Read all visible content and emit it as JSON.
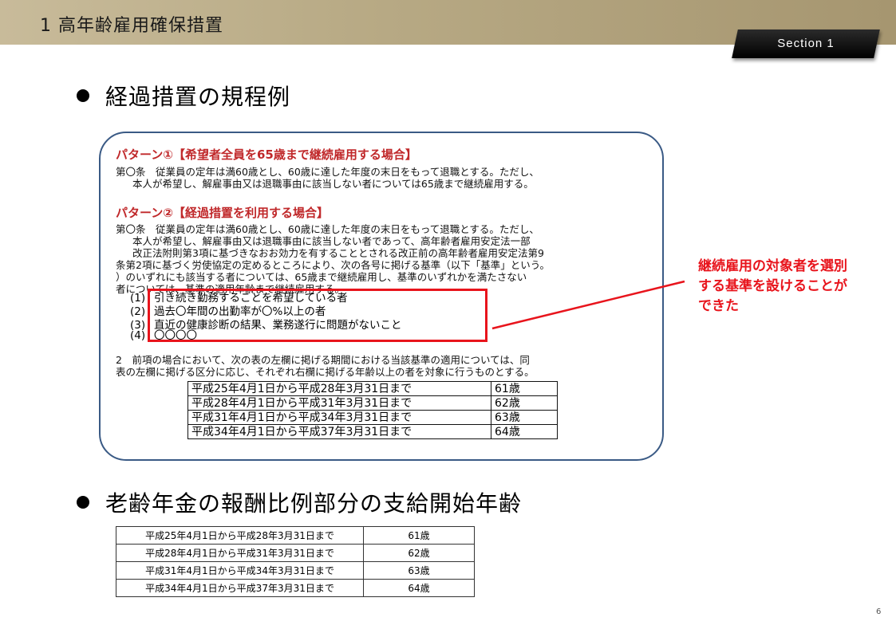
{
  "header": {
    "title": "1 高年齢雇用確保措置",
    "section": "Section 1"
  },
  "bullets": [
    "経過措置の規程例",
    "老齢年金の報酬比例部分の支給開始年齢"
  ],
  "pattern1": {
    "heading": "パターン①【希望者全員を65歳まで継続雇用する場合】",
    "lines": [
      "第〇条　従業員の定年は満60歳とし、60歳に達した年度の末日をもって退職とする。ただし、",
      "本人が希望し、解雇事由又は退職事由に該当しない者については65歳まで継続雇用する。"
    ]
  },
  "pattern2": {
    "heading": "パターン②【経過措置を利用する場合】",
    "lines": [
      "第〇条　従業員の定年は満60歳とし、60歳に達した年度の末日をもって退職とする。ただし、",
      "本人が希望し、解雇事由又は退職事由に該当しない者であって、高年齢者雇用安定法一部",
      "改正法附則第3項に基づきなおお効力を有することとされる改正前の高年齢者雇用安定法第9",
      "条第2項に基づく労使協定の定めるところにより、次の各号に掲げる基準（以下「基準」という。",
      "）のいずれにも該当する者については、65歳まで継続雇用し、基準のいずれかを満たさない",
      "者については、基準の適用年齢まで継続雇用する。"
    ],
    "items": [
      {
        "num": "(1)",
        "text": "引き続き勤務することを希望している者"
      },
      {
        "num": "(2)",
        "text": "過去〇年間の出勤率が〇%以上の者"
      },
      {
        "num": "(3)",
        "text": "直近の健康診断の結果、業務遂行に問題がないこと"
      },
      {
        "num": "(4)",
        "text": "〇〇〇〇"
      }
    ],
    "para2": [
      "2　前項の場合において、次の表の左欄に掲げる期間における当該基準の適用については、同",
      "表の左欄に掲げる区分に応じ、それぞれ右欄に掲げる年齢以上の者を対象に行うものとする。"
    ]
  },
  "inner_table": [
    {
      "period": "平成25年4月1日から平成28年3月31日まで",
      "age": "61歳"
    },
    {
      "period": "平成28年4月1日から平成31年3月31日まで",
      "age": "62歳"
    },
    {
      "period": "平成31年4月1日から平成34年3月31日まで",
      "age": "63歳"
    },
    {
      "period": "平成34年4月1日から平成37年3月31日まで",
      "age": "64歳"
    }
  ],
  "callout": [
    "継続雇用の対象者を選別",
    "する基準を設けることが",
    "できた"
  ],
  "outer_table": [
    {
      "period": "平成25年4月1日から平成28年3月31日まで",
      "age": "61歳"
    },
    {
      "period": "平成28年4月1日から平成31年3月31日まで",
      "age": "62歳"
    },
    {
      "period": "平成31年4月1日から平成34年3月31日まで",
      "age": "63歳"
    },
    {
      "period": "平成34年4月1日から平成37年3月31日まで",
      "age": "64歳"
    }
  ],
  "page_number": "6",
  "colors": {
    "accent_red": "#e8141c",
    "heading_red": "#c0282a",
    "box_border": "#3a5a85",
    "header_tan": "#b8aa85"
  }
}
